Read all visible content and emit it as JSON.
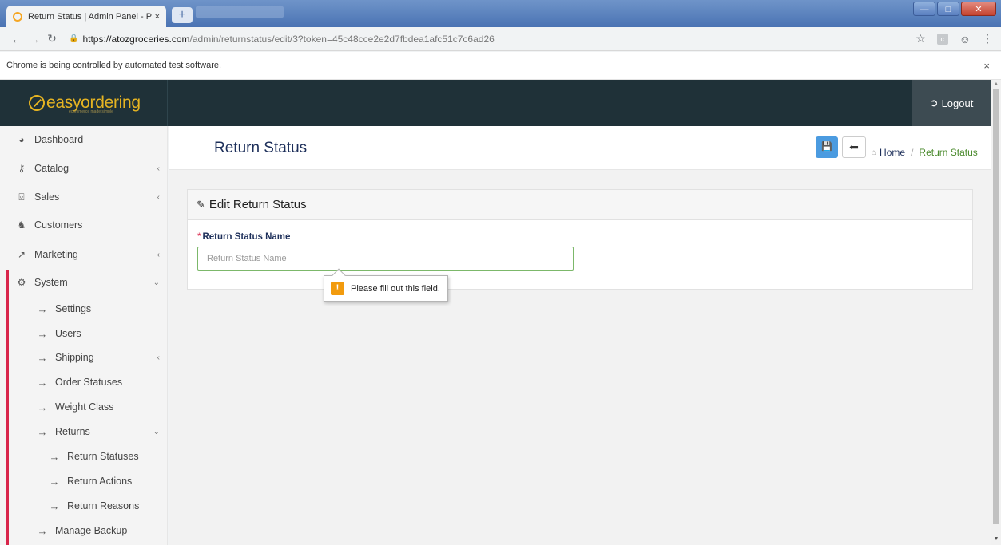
{
  "browser": {
    "tab_title": "Return Status | Admin Panel - Po",
    "tab_close": "×",
    "new_tab": "+",
    "url_domain": "https://atozgroceries.com",
    "url_path": "/admin/returnstatus/edit/3?token=45c48cce2e2d7fbdea1afc51c7c6ad26",
    "ext_label": "c",
    "infobar_text": "Chrome is being controlled by automated test software.",
    "infobar_close": "×"
  },
  "header": {
    "logo_text": "easyordering",
    "logo_tagline": "ecommerce made simple",
    "logout_label": "Logout"
  },
  "sidebar": {
    "items": [
      {
        "label": "Dashboard",
        "icon": "dashboard-icon"
      },
      {
        "label": "Catalog",
        "icon": "tag-icon"
      },
      {
        "label": "Sales",
        "icon": "cart-icon"
      },
      {
        "label": "Customers",
        "icon": "user-icon"
      },
      {
        "label": "Marketing",
        "icon": "share-icon"
      },
      {
        "label": "System",
        "icon": "gear-icon"
      }
    ],
    "system_sub": [
      {
        "label": "Settings"
      },
      {
        "label": "Users"
      },
      {
        "label": "Shipping"
      },
      {
        "label": "Order Statuses"
      },
      {
        "label": "Weight Class"
      },
      {
        "label": "Returns"
      }
    ],
    "returns_sub": [
      {
        "label": "Return Statuses"
      },
      {
        "label": "Return Actions"
      },
      {
        "label": "Return Reasons"
      }
    ],
    "manage_backup": "Manage Backup"
  },
  "page": {
    "title": "Return Status",
    "breadcrumb_home": "Home",
    "breadcrumb_sep": "/",
    "breadcrumb_current": "Return Status"
  },
  "form": {
    "panel_title": "Edit Return Status",
    "required_mark": "*",
    "field_label": "Return Status Name",
    "field_placeholder": "Return Status Name",
    "field_value": "",
    "validation_message": "Please fill out this field.",
    "validation_icon": "!"
  },
  "colors": {
    "header_bg": "#1f3138",
    "logo": "#e6b422",
    "accent_red": "#d9264b",
    "primary_blue": "#4b9be0",
    "breadcrumb_green": "#4a8a2c"
  }
}
